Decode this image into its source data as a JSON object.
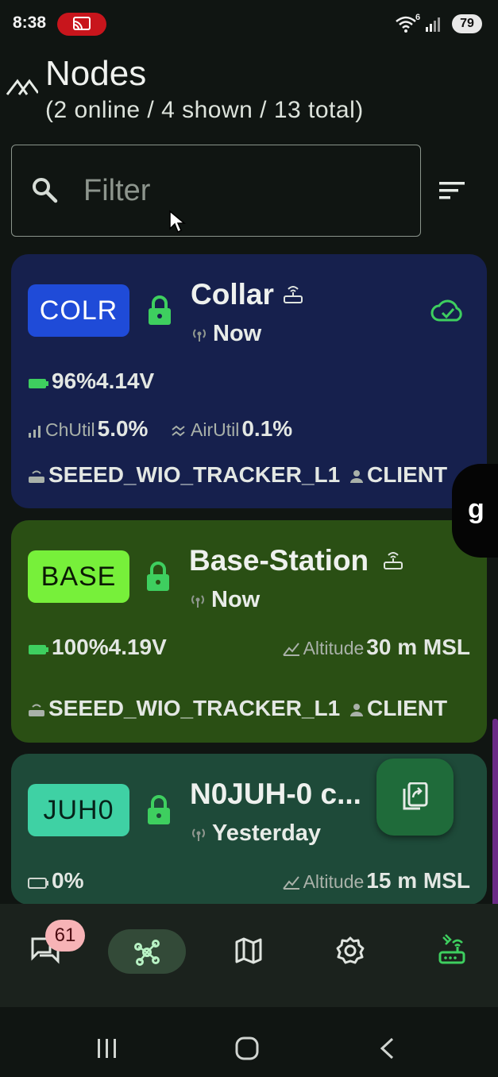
{
  "status_bar": {
    "time": "8:38",
    "battery": "79",
    "wifi_label": "6"
  },
  "header": {
    "title": "Nodes",
    "subtitle": "(2 online / 4 shown / 13 total)"
  },
  "filter": {
    "placeholder": "Filter",
    "value": ""
  },
  "nodes": [
    {
      "short": "COLR",
      "name": "Collar",
      "last_heard": "Now",
      "battery": "96%",
      "voltage": "4.14V",
      "chutil_label": "ChUtil",
      "chutil": "5.0%",
      "airutil_label": "AirUtil",
      "airutil": "0.1%",
      "hardware": "SEEED_WIO_TRACKER_L1",
      "role": "CLIENT",
      "card_color": "#16204d",
      "badge_color": "#1f4bd8"
    },
    {
      "short": "BASE",
      "name": "Base-Station",
      "last_heard": "Now",
      "battery": "100%",
      "voltage": "4.19V",
      "altitude_label": "Altitude",
      "altitude": "30 m MSL",
      "hardware": "SEEED_WIO_TRACKER_L1",
      "role": "CLIENT",
      "card_color": "#2a4f14",
      "badge_color": "#77f03a"
    },
    {
      "short": "JUH0",
      "name": "N0JUH-0 c...",
      "last_heard": "Yesterday",
      "battery": "0%",
      "altitude_label": "Altitude",
      "altitude": "15 m MSL",
      "card_color": "#1e4a39",
      "badge_color": "#3fd1a4"
    }
  ],
  "side_bubble": {
    "label": "g"
  },
  "bottom_nav": {
    "messages_badge": "61",
    "items": [
      "messages-icon",
      "nodes-icon",
      "map-icon",
      "settings-icon",
      "connection-icon"
    ]
  },
  "colors": {
    "accent_green": "#3ecf5f",
    "background": "#101512"
  }
}
